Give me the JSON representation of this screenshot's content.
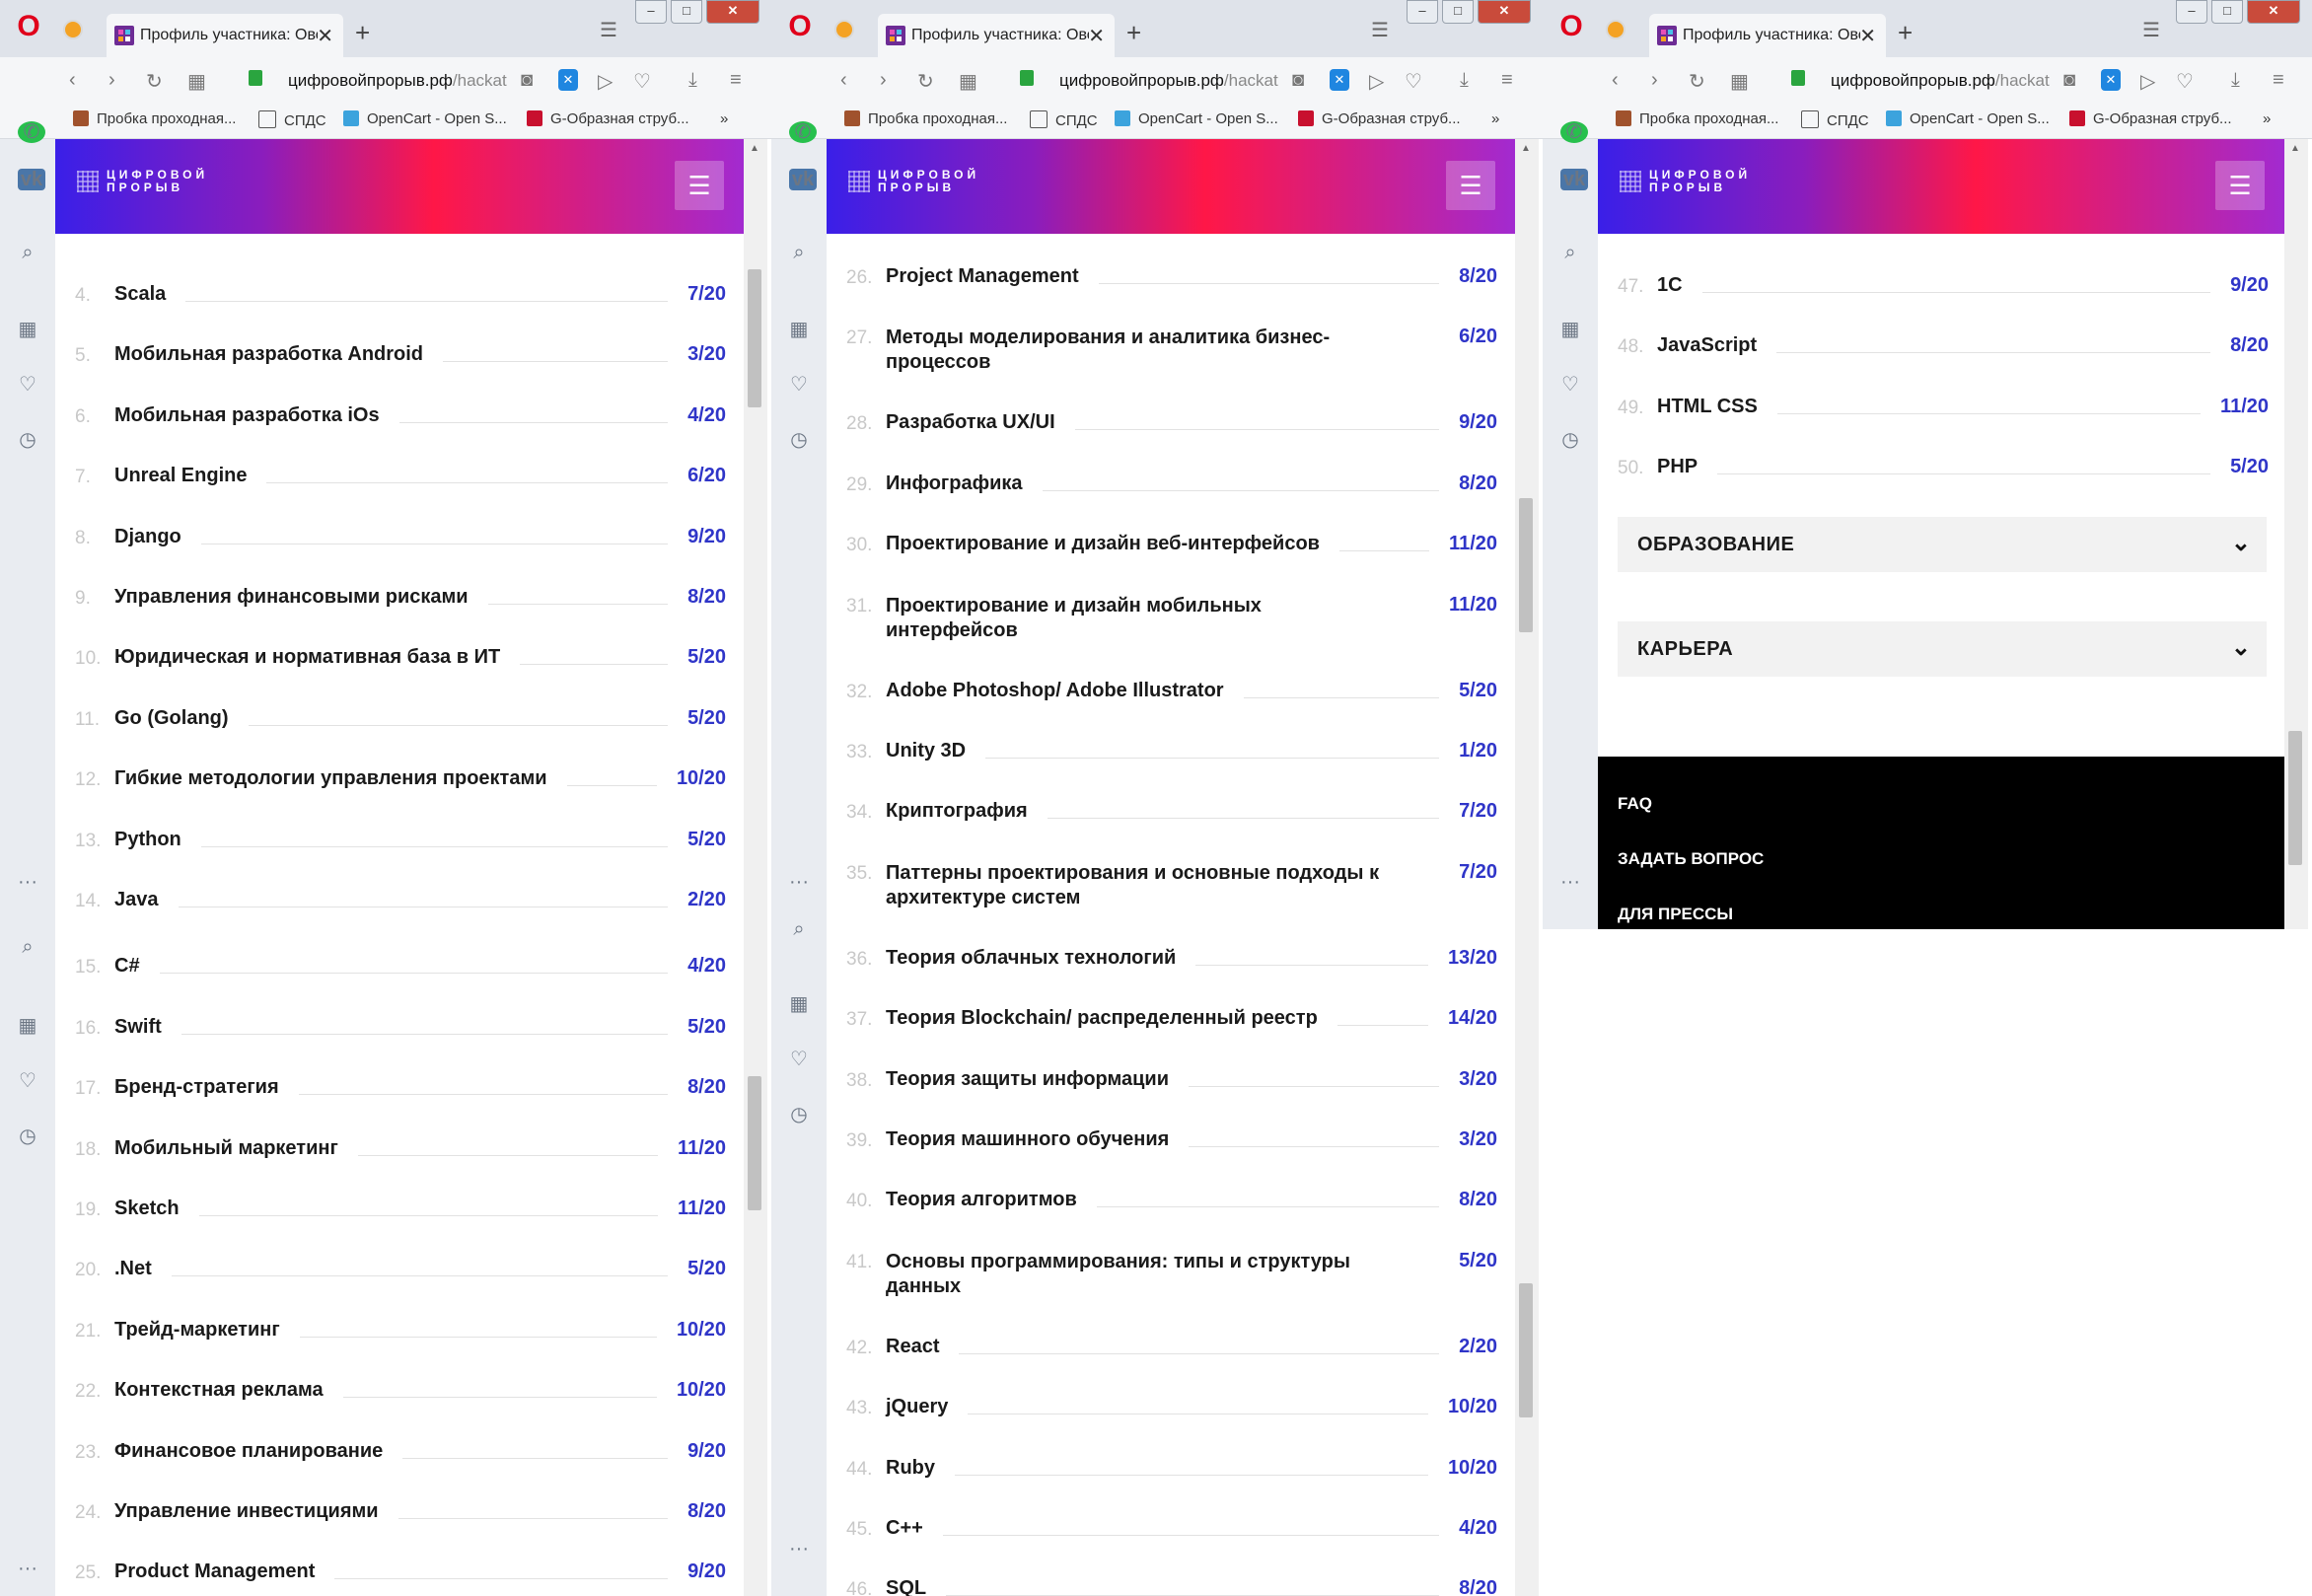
{
  "browser": {
    "tab_title": "Профиль участника: Овся",
    "url_main": "цифровойпрорыв.рф",
    "url_path": "/hackat",
    "bookmarks": [
      "Пробка проходная...",
      "СПДС",
      "OpenCart - Open S...",
      "G-Образная струб..."
    ],
    "bookmarks_more": "»",
    "new_tab": "+",
    "opera_logo": "O",
    "vk_label": "vk",
    "more_dots": "···"
  },
  "site": {
    "logo_line1": "ЦИФРОВОЙ",
    "logo_line2": "ПРОРЫВ",
    "menu_icon": "☰"
  },
  "panels": [
    {
      "rows": [
        {
          "num": "4.",
          "name": "Scala",
          "score": "7/20"
        },
        {
          "num": "5.",
          "name": "Мобильная разработка Android",
          "score": "3/20"
        },
        {
          "num": "6.",
          "name": "Мобильная разработка iOs",
          "score": "4/20"
        },
        {
          "num": "7.",
          "name": "Unreal Engine",
          "score": "6/20"
        },
        {
          "num": "8.",
          "name": "Django",
          "score": "9/20"
        },
        {
          "num": "9.",
          "name": "Управления финансовыми рисками",
          "score": "8/20"
        },
        {
          "num": "10.",
          "name": "Юридическая и нормативная база в ИТ",
          "score": "5/20"
        },
        {
          "num": "11.",
          "name": "Go (Golang)",
          "score": "5/20"
        },
        {
          "num": "12.",
          "name": "Гибкие методологии управления проектами",
          "score": "10/20"
        },
        {
          "num": "13.",
          "name": "Python",
          "score": "5/20"
        },
        {
          "num": "14.",
          "name": "Java",
          "score": "2/20"
        },
        {
          "num": "15.",
          "name": "C#",
          "score": "4/20"
        },
        {
          "num": "16.",
          "name": "Swift",
          "score": "5/20"
        },
        {
          "num": "17.",
          "name": "Бренд-стратегия",
          "score": "8/20"
        },
        {
          "num": "18.",
          "name": "Мобильный маркетинг",
          "score": "11/20"
        },
        {
          "num": "19.",
          "name": "Sketch",
          "score": "11/20"
        },
        {
          "num": "20.",
          "name": ".Net",
          "score": "5/20"
        },
        {
          "num": "21.",
          "name": "Трейд-маркетинг",
          "score": "10/20"
        },
        {
          "num": "22.",
          "name": "Контекстная реклама",
          "score": "10/20"
        },
        {
          "num": "23.",
          "name": "Финансовое планирование",
          "score": "9/20"
        },
        {
          "num": "24.",
          "name": "Управление инвестициями",
          "score": "8/20"
        },
        {
          "num": "25.",
          "name": "Product Management",
          "score": "9/20"
        }
      ]
    },
    {
      "rows": [
        {
          "num": "26.",
          "name": "Project Management",
          "score": "8/20"
        },
        {
          "num": "27.",
          "name": "Методы моделирования и аналитика бизнес-процессов",
          "score": "6/20"
        },
        {
          "num": "28.",
          "name": "Разработка UX/UI",
          "score": "9/20"
        },
        {
          "num": "29.",
          "name": "Инфографика",
          "score": "8/20"
        },
        {
          "num": "30.",
          "name": "Проектирование и дизайн веб-интерфейсов",
          "score": "11/20"
        },
        {
          "num": "31.",
          "name": "Проектирование и дизайн мобильных интерфейсов",
          "score": "11/20"
        },
        {
          "num": "32.",
          "name": "Adobe Photoshop/ Adobe Illustrator",
          "score": "5/20"
        },
        {
          "num": "33.",
          "name": "Unity 3D",
          "score": "1/20"
        },
        {
          "num": "34.",
          "name": "Криптография",
          "score": "7/20"
        },
        {
          "num": "35.",
          "name": "Паттерны проектирования и основные подходы к архитектуре систем",
          "score": "7/20"
        },
        {
          "num": "36.",
          "name": "Теория облачных технологий",
          "score": "13/20"
        },
        {
          "num": "37.",
          "name": "Теория Blockchain/ распределенный реестр",
          "score": "14/20"
        },
        {
          "num": "38.",
          "name": "Теория защиты информации",
          "score": "3/20"
        },
        {
          "num": "39.",
          "name": "Теория машинного обучения",
          "score": "3/20"
        },
        {
          "num": "40.",
          "name": "Теория алгоритмов",
          "score": "8/20"
        },
        {
          "num": "41.",
          "name": "Основы программирования: типы и структуры данных",
          "score": "5/20"
        },
        {
          "num": "42.",
          "name": "React",
          "score": "2/20"
        },
        {
          "num": "43.",
          "name": "jQuery",
          "score": "10/20"
        },
        {
          "num": "44.",
          "name": "Ruby",
          "score": "10/20"
        },
        {
          "num": "45.",
          "name": "C++",
          "score": "4/20"
        },
        {
          "num": "46.",
          "name": "SQL",
          "score": "8/20"
        }
      ]
    },
    {
      "rows": [
        {
          "num": "47.",
          "name": "1C",
          "score": "9/20"
        },
        {
          "num": "48.",
          "name": "JavaScript",
          "score": "8/20"
        },
        {
          "num": "49.",
          "name": "HTML CSS",
          "score": "11/20"
        },
        {
          "num": "50.",
          "name": "PHP",
          "score": "5/20"
        }
      ],
      "accordions": [
        "ОБРАЗОВАНИЕ",
        "КАРЬЕРА"
      ],
      "footer_links": [
        "FAQ",
        "ЗАДАТЬ ВОПРОС",
        "ДЛЯ ПРЕССЫ"
      ]
    }
  ]
}
